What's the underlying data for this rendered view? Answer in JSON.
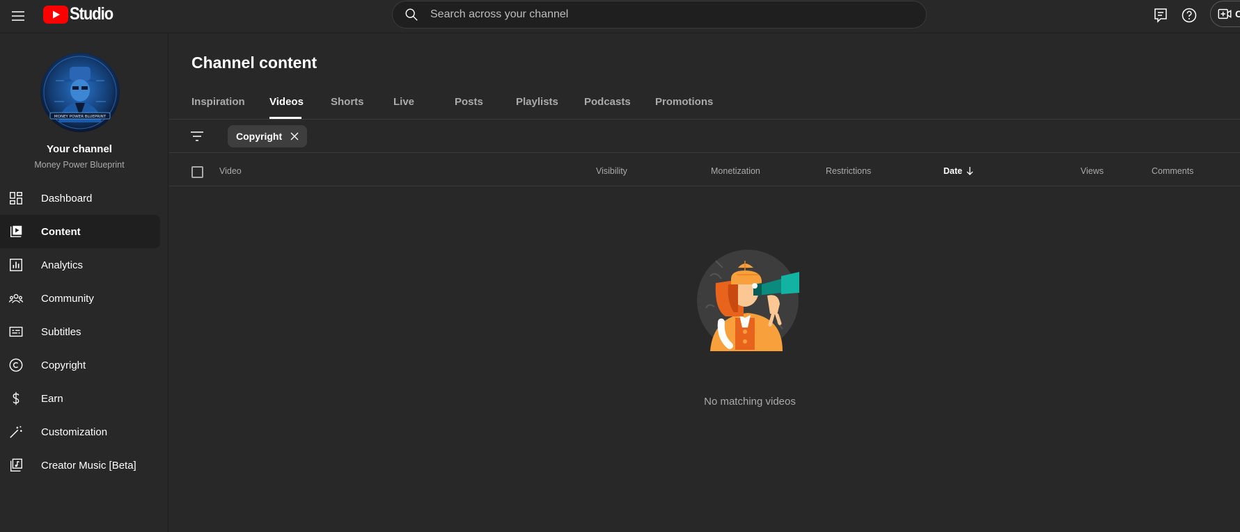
{
  "header": {
    "logo_text": "Studio",
    "search_placeholder": "Search across your channel",
    "create_label": "C"
  },
  "sidebar": {
    "your_channel": "Your channel",
    "channel_name": "Money Power Blueprint",
    "avatar_caption": "MONEY POWER BLUEPRINT",
    "items": [
      {
        "label": "Dashboard",
        "icon": "dashboard-icon"
      },
      {
        "label": "Content",
        "icon": "content-icon",
        "active": true
      },
      {
        "label": "Analytics",
        "icon": "analytics-icon"
      },
      {
        "label": "Community",
        "icon": "community-icon"
      },
      {
        "label": "Subtitles",
        "icon": "subtitles-icon"
      },
      {
        "label": "Copyright",
        "icon": "copyright-icon"
      },
      {
        "label": "Earn",
        "icon": "dollar-icon"
      },
      {
        "label": "Customization",
        "icon": "magic-wand-icon"
      },
      {
        "label": "Creator Music [Beta]",
        "icon": "music-icon"
      }
    ]
  },
  "main": {
    "title": "Channel content",
    "tabs": [
      {
        "label": "Inspiration"
      },
      {
        "label": "Videos",
        "active": true
      },
      {
        "label": "Shorts"
      },
      {
        "label": "Live"
      },
      {
        "label": "Posts"
      },
      {
        "label": "Playlists"
      },
      {
        "label": "Podcasts"
      },
      {
        "label": "Promotions"
      }
    ],
    "filter_chip": "Copyright",
    "columns": {
      "video": "Video",
      "visibility": "Visibility",
      "monetization": "Monetization",
      "restrictions": "Restrictions",
      "date": "Date",
      "views": "Views",
      "comments": "Comments"
    },
    "empty_message": "No matching videos"
  },
  "colors": {
    "background": "#282828",
    "youtube_red": "#ff0000",
    "text_secondary": "#aaaaaa",
    "active_bg": "#1f1f1f"
  }
}
